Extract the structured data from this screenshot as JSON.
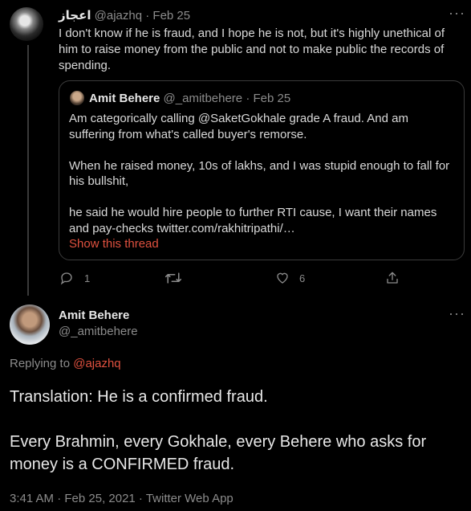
{
  "parent_tweet": {
    "author_name": "اعجاز",
    "author_handle": "@ajazhq",
    "date_sep": "·",
    "date": "Feb 25",
    "more": "···",
    "text": "I don't know if he is fraud, and I hope he is not, but it's highly unethical of him to raise money from the public and not to make public the records of spending.",
    "quoted": {
      "author_name": "Amit Behere",
      "author_handle": "@_amitbehere",
      "date_sep": "·",
      "date": "Feb 25",
      "paragraphs": [
        "Am categorically calling @SaketGokhale grade A fraud. And am suffering from what's called buyer's remorse.",
        "When he raised money, 10s of lakhs, and I was stupid enough to fall for his bullshit,",
        "he said he would hire people to further RTI cause, I want their names and pay-checks twitter.com/rakhitripathi/…"
      ],
      "show_thread": "Show this thread"
    },
    "actions": {
      "reply_icon": "reply-icon",
      "reply_count": "1",
      "retweet_icon": "retweet-icon",
      "like_icon": "heart-icon",
      "like_count": "6",
      "share_icon": "share-icon"
    }
  },
  "main_tweet": {
    "author_name": "Amit Behere",
    "author_handle": "@_amitbehere",
    "more": "···",
    "replying_prefix": "Replying to ",
    "replying_to": "@ajazhq",
    "paragraphs": [
      "Translation: He is a confirmed fraud.",
      "Every Brahmin, every Gokhale, every Behere who asks for money is a CONFIRMED fraud."
    ],
    "timestamp": "3:41 AM · Feb 25, 2021 · Twitter Web App"
  },
  "colors": {
    "background": "#000000",
    "link": "#e0513f",
    "muted": "#8b8b8b",
    "border": "#3b3b3b"
  }
}
